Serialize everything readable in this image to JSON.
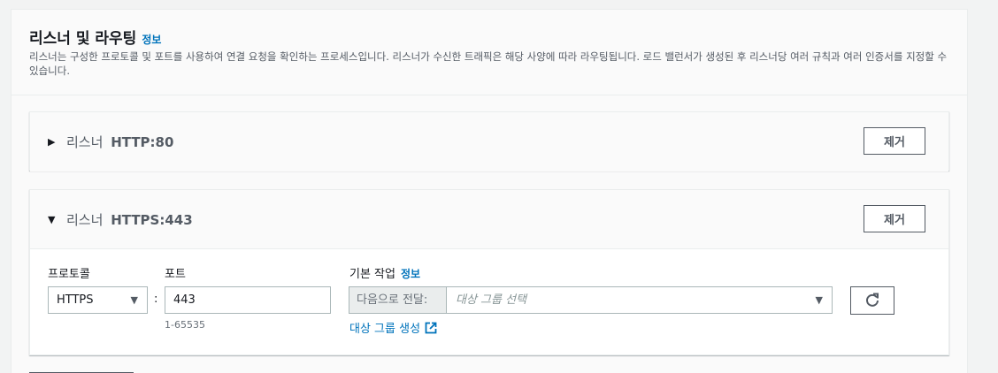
{
  "section": {
    "title": "리스너 및 라우팅",
    "info": "정보",
    "description": "리스너는 구성한 프로토콜 및 포트를 사용하여 연결 요청을 확인하는 프로세스입니다. 리스너가 수신한 트래픽은 해당 사양에 따라 라우팅됩니다. 로드 밸런서가 생성된 후 리스너당 여러 규칙과 여러 인증서를 지정할 수 있습니다."
  },
  "listeners": [
    {
      "prefix": "리스너",
      "name": "HTTP:80",
      "expanded": false,
      "remove_label": "제거"
    },
    {
      "prefix": "리스너",
      "name": "HTTPS:443",
      "expanded": true,
      "remove_label": "제거",
      "protocol_label": "프로토콜",
      "protocol_value": "HTTPS",
      "port_label": "포트",
      "port_value": "443",
      "port_hint": "1-65535",
      "separator": ":",
      "default_action_label": "기본 작업",
      "default_action_info": "정보",
      "action_prefix": "다음으로 전달:",
      "target_group_placeholder": "대상 그룹 선택",
      "create_target_group": "대상 그룹 생성"
    }
  ],
  "icons": {
    "collapsed": "caret-right-icon",
    "expanded": "caret-down-icon",
    "dropdown": "caret-down-icon",
    "refresh": "refresh-icon",
    "external": "external-link-icon"
  },
  "colors": {
    "link": "#0073bb",
    "border": "#aab7b8",
    "text": "#16191f",
    "muted": "#545b64"
  }
}
